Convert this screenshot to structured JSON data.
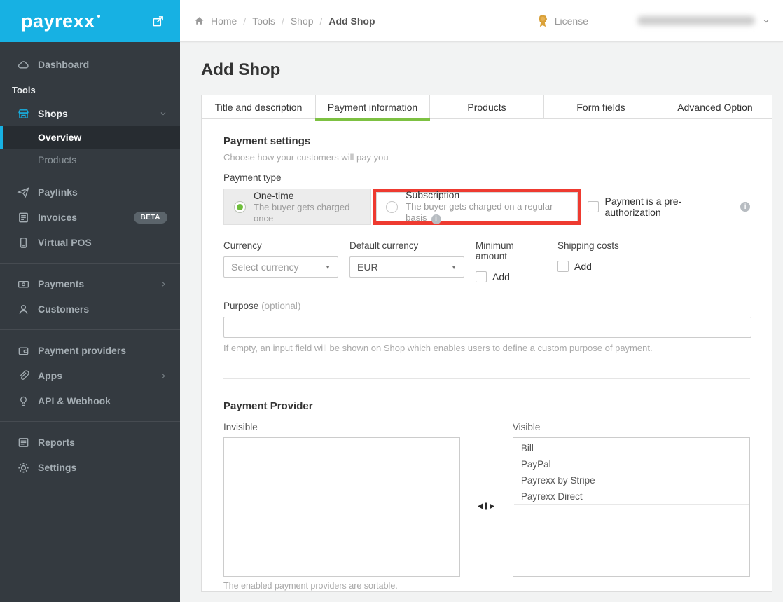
{
  "brand": {
    "logo": "payrexx"
  },
  "header": {
    "breadcrumb": {
      "home": "Home",
      "tools": "Tools",
      "shop": "Shop",
      "current": "Add Shop",
      "separator": "/"
    },
    "license": {
      "label": "License"
    }
  },
  "sidebar": {
    "dashboard": "Dashboard",
    "tools_section": "Tools",
    "shops": "Shops",
    "overview": "Overview",
    "products": "Products",
    "paylinks": "Paylinks",
    "invoices": "Invoices",
    "invoices_badge": "BETA",
    "virtual_pos": "Virtual POS",
    "payments": "Payments",
    "customers": "Customers",
    "payment_providers": "Payment providers",
    "apps": "Apps",
    "api_webhook": "API & Webhook",
    "reports": "Reports",
    "settings": "Settings"
  },
  "main": {
    "title": "Add Shop",
    "tabs": [
      {
        "label": "Title and description",
        "active": false
      },
      {
        "label": "Payment information",
        "active": true
      },
      {
        "label": "Products",
        "active": false
      },
      {
        "label": "Form fields",
        "active": false
      },
      {
        "label": "Advanced Option",
        "active": false
      }
    ],
    "payment_settings": {
      "heading": "Payment settings",
      "subheading": "Choose how your customers will pay you",
      "payment_type_label": "Payment type",
      "one_time_label": "One-time",
      "one_time_description": "The buyer gets charged once",
      "one_time_selected": true,
      "subscription_label": "Subscription",
      "subscription_description": "The buyer gets charged on a regular basis",
      "subscription_selected": false,
      "subscription_highlighted": true,
      "preauth_label": "Payment is a pre-authorization",
      "preauth_checked": false,
      "currency_label": "Currency",
      "currency_value": "Select currency",
      "default_currency_label": "Default currency",
      "default_currency_value": "EUR",
      "minimum_amount_label": "Minimum amount",
      "minimum_amount_add": "Add",
      "minimum_amount_checked": false,
      "shipping_costs_label": "Shipping costs",
      "shipping_costs_add": "Add",
      "shipping_costs_checked": false,
      "purpose_label": "Purpose",
      "purpose_optional": "(optional)",
      "purpose_value": "",
      "purpose_help": "If empty, an input field will be shown on Shop which enables users to define a custom purpose of payment."
    },
    "payment_provider": {
      "heading": "Payment Provider",
      "invisible_label": "Invisible",
      "visible_label": "Visible",
      "visible_items": [
        "Bill",
        "PayPal",
        "Payrexx by Stripe",
        "Payrexx Direct"
      ],
      "note": "The enabled payment providers are sortable."
    }
  },
  "colors": {
    "brand_cyan": "#17b1e3",
    "active_tab_green": "#7dc142",
    "annotation_red": "#ee3a30",
    "license_gold": "#dba238",
    "sidebar_bg": "#343a40"
  },
  "ui": {
    "select_caret": "▼",
    "info_glyph": "i"
  }
}
